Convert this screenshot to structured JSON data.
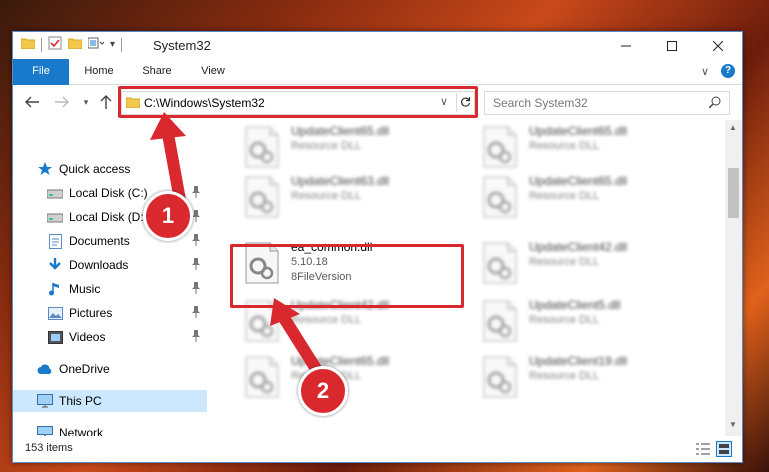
{
  "window": {
    "title": "System32"
  },
  "ribbon": {
    "tabs": [
      {
        "label": "File"
      },
      {
        "label": "Home"
      },
      {
        "label": "Share"
      },
      {
        "label": "View"
      }
    ]
  },
  "address": {
    "path": "C:\\Windows\\System32",
    "search_placeholder": "Search System32"
  },
  "nav": {
    "items": [
      {
        "label": "Quick access",
        "icon": "star-icon"
      },
      {
        "label": "Local Disk (C:)",
        "icon": "drive-icon",
        "pinned": true
      },
      {
        "label": "Local Disk (D:)",
        "icon": "drive-icon",
        "pinned": true
      },
      {
        "label": "Documents",
        "icon": "documents-icon",
        "pinned": true
      },
      {
        "label": "Downloads",
        "icon": "download-icon",
        "pinned": true
      },
      {
        "label": "Music",
        "icon": "music-icon",
        "pinned": true
      },
      {
        "label": "Pictures",
        "icon": "pictures-icon",
        "pinned": true
      },
      {
        "label": "Videos",
        "icon": "videos-icon",
        "pinned": true
      },
      {
        "label": "OneDrive",
        "icon": "cloud-icon"
      },
      {
        "label": "This PC",
        "icon": "computer-icon",
        "selected": true
      },
      {
        "label": "Network",
        "icon": "network-icon"
      }
    ]
  },
  "files": [
    {
      "name": "UpdateClient65.dll",
      "type": "Resource DLL",
      "blurred": true
    },
    {
      "name": "UpdateClient65.dll",
      "type": "Resource DLL",
      "blurred": true
    },
    {
      "name": "UpdateClient63.dll",
      "type": "Resource DLL",
      "blurred": true
    },
    {
      "name": "UpdateClient65.dll",
      "type": "Resource DLL",
      "blurred": true
    },
    {
      "name": "ea_common.dll",
      "version": "5.10.18",
      "type": "8FileVersion",
      "blurred": false
    },
    {
      "name": "UpdateClient42.dll",
      "type": "Resource DLL",
      "blurred": true
    },
    {
      "name": "UpdateClient42.dll",
      "type": "Resource DLL",
      "blurred": true
    },
    {
      "name": "UpdateClient5.dll",
      "type": "Resource DLL",
      "blurred": true
    },
    {
      "name": "UpdateClient65.dll",
      "type": "Resource DLL",
      "blurred": true
    },
    {
      "name": "UpdateClient19.dll",
      "type": "Resource DLL",
      "blurred": true
    }
  ],
  "status": {
    "item_count": "153 items"
  },
  "annotations": {
    "step1": "1",
    "step2": "2"
  },
  "colors": {
    "accent": "#1979ca",
    "highlight": "#d9292f",
    "selected": "#cce8ff"
  }
}
